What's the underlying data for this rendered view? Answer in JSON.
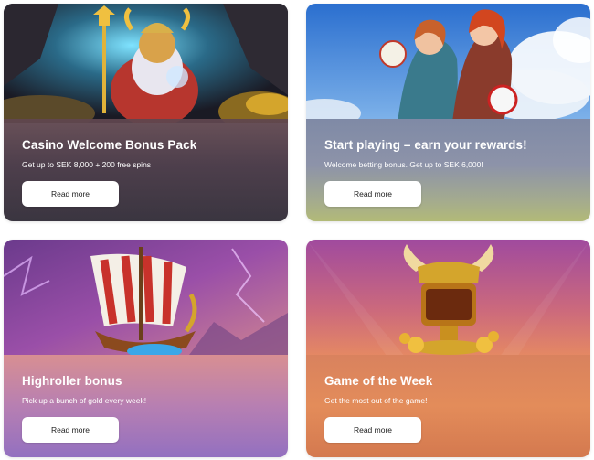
{
  "cards": [
    {
      "title": "Casino Welcome Bonus Pack",
      "subtitle": "Get up to SEK 8,000 + 200 free spins",
      "button_label": "Read more",
      "image_icon": "viking-king-icon"
    },
    {
      "title": "Start playing – earn your rewards!",
      "subtitle": "Welcome betting bonus. Get up to SEK 6,000!",
      "button_label": "Read more",
      "image_icon": "warrior-women-icon"
    },
    {
      "title": "Highroller bonus",
      "subtitle": "Pick up a bunch of gold every week!",
      "button_label": "Read more",
      "image_icon": "viking-ship-icon"
    },
    {
      "title": "Game of the Week",
      "subtitle": "Get the most out of the game!",
      "button_label": "Read more",
      "image_icon": "golden-777-chalice-icon"
    }
  ],
  "colors": {
    "card1_panel": "#4e3f4c",
    "card2_panel": "#8d93a9",
    "card3_panel": "#b77fb2",
    "card4_panel": "#e38c5a",
    "button_bg": "#ffffff",
    "title_text": "#ffffff"
  }
}
